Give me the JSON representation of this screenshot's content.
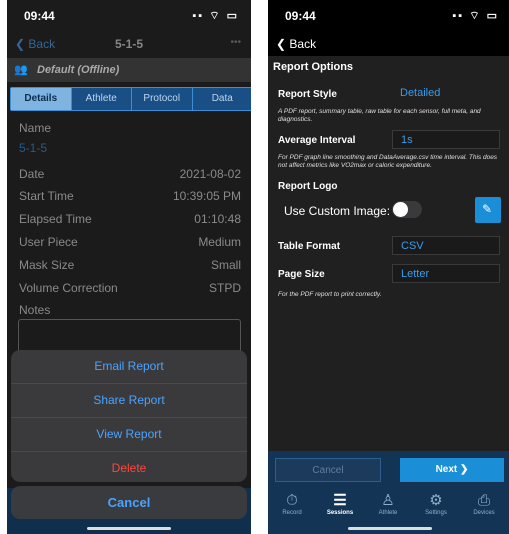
{
  "left": {
    "status_time": "09:44",
    "status_icons": "▪▪ ⌔ ▭",
    "nav": {
      "back": "Back",
      "title": "5-1-5",
      "more": "•••"
    },
    "profile": "Default (Offline)",
    "segments": [
      "Details",
      "Athlete",
      "Protocol",
      "Data"
    ],
    "name_label": "Name",
    "name_value": "5-1-5",
    "rows": [
      {
        "label": "Date",
        "value": "2021-08-02"
      },
      {
        "label": "Start Time",
        "value": "10:39:05 PM"
      },
      {
        "label": "Elapsed Time",
        "value": "01:10:48"
      },
      {
        "label": "User Piece",
        "value": "Medium"
      },
      {
        "label": "Mask Size",
        "value": "Small"
      },
      {
        "label": "Volume Correction",
        "value": "STPD"
      }
    ],
    "notes_label": "Notes",
    "actions": {
      "email": "Email Report",
      "share": "Share Report",
      "view": "View Report",
      "delete": "Delete",
      "cancel": "Cancel"
    },
    "colors": {
      "accent": "#4aa3ff",
      "danger": "#ff453a"
    }
  },
  "right": {
    "status_time": "09:44",
    "status_icons": "▪▪ ⌔ ▭",
    "nav": {
      "back": "Back"
    },
    "section_title": "Report Options",
    "report_style_label": "Report Style",
    "report_style_value": "Detailed",
    "report_style_help": "A PDF report, summary table, raw table for each sensor, full meta, and diagnostics.",
    "avg_interval_label": "Average Interval",
    "avg_interval_value": "1s",
    "avg_interval_help": "For PDF graph line smoothing and DataAverage.csv time interval. This does not affect metrics like VO2max or caloric expenditure.",
    "report_logo_label": "Report Logo",
    "custom_image_label": "Use Custom Image:",
    "custom_image_on": false,
    "table_format_label": "Table Format",
    "table_format_value": "CSV",
    "page_size_label": "Page Size",
    "page_size_value": "Letter",
    "page_size_help": "For the PDF report to print correctly.",
    "cancel": "Cancel",
    "next": "Next",
    "tabs": [
      {
        "label": "Record",
        "icon": "stopwatch-icon"
      },
      {
        "label": "Sessions",
        "icon": "list-icon"
      },
      {
        "label": "Athlete",
        "icon": "person-icon"
      },
      {
        "label": "Settings",
        "icon": "gear-icon"
      },
      {
        "label": "Devices",
        "icon": "devices-icon"
      }
    ],
    "colors": {
      "accent": "#1a8fd8",
      "field_text": "#3a9bea"
    }
  }
}
